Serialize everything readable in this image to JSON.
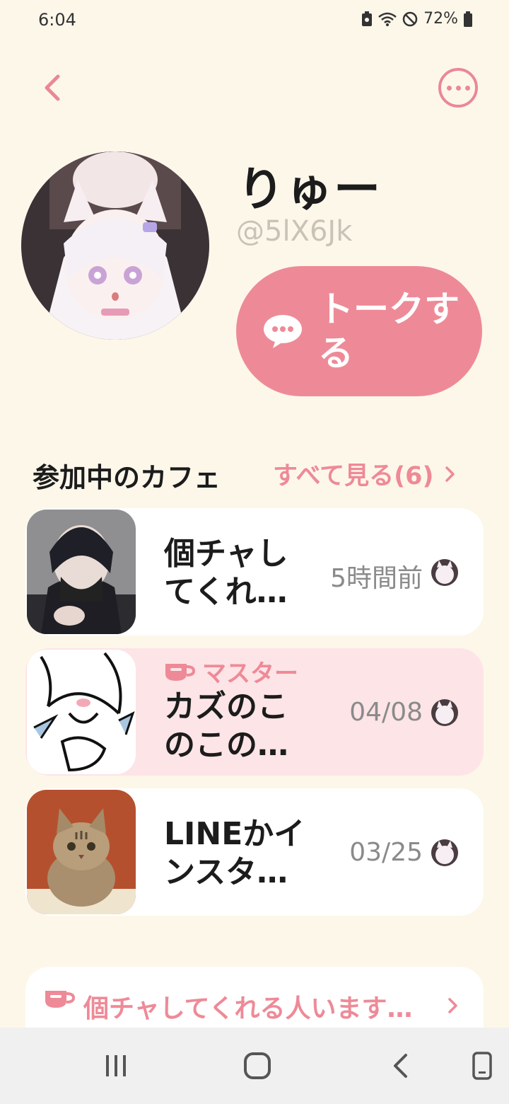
{
  "status": {
    "time": "6:04",
    "battery": "72%"
  },
  "profile": {
    "name": "りゅー",
    "handle": "@5lX6Jk",
    "talk_button": "トークする"
  },
  "cafes_section": {
    "title": "参加中のカフェ",
    "see_all": "すべて見る(6)"
  },
  "cafes": [
    {
      "title": "個チャしてくれ…",
      "time": "5時間前",
      "master": false
    },
    {
      "title": "カズのこのこの…",
      "time": "04/08",
      "master": true,
      "master_label": "マスター"
    },
    {
      "title": "LINEかインスタ…",
      "time": "03/25",
      "master": false
    }
  ],
  "board_link": {
    "label": "個チャしてくれる人います…"
  },
  "colors": {
    "accent": "#ee8a97",
    "background": "#fdf7ea",
    "master_card": "#fde4e6"
  }
}
